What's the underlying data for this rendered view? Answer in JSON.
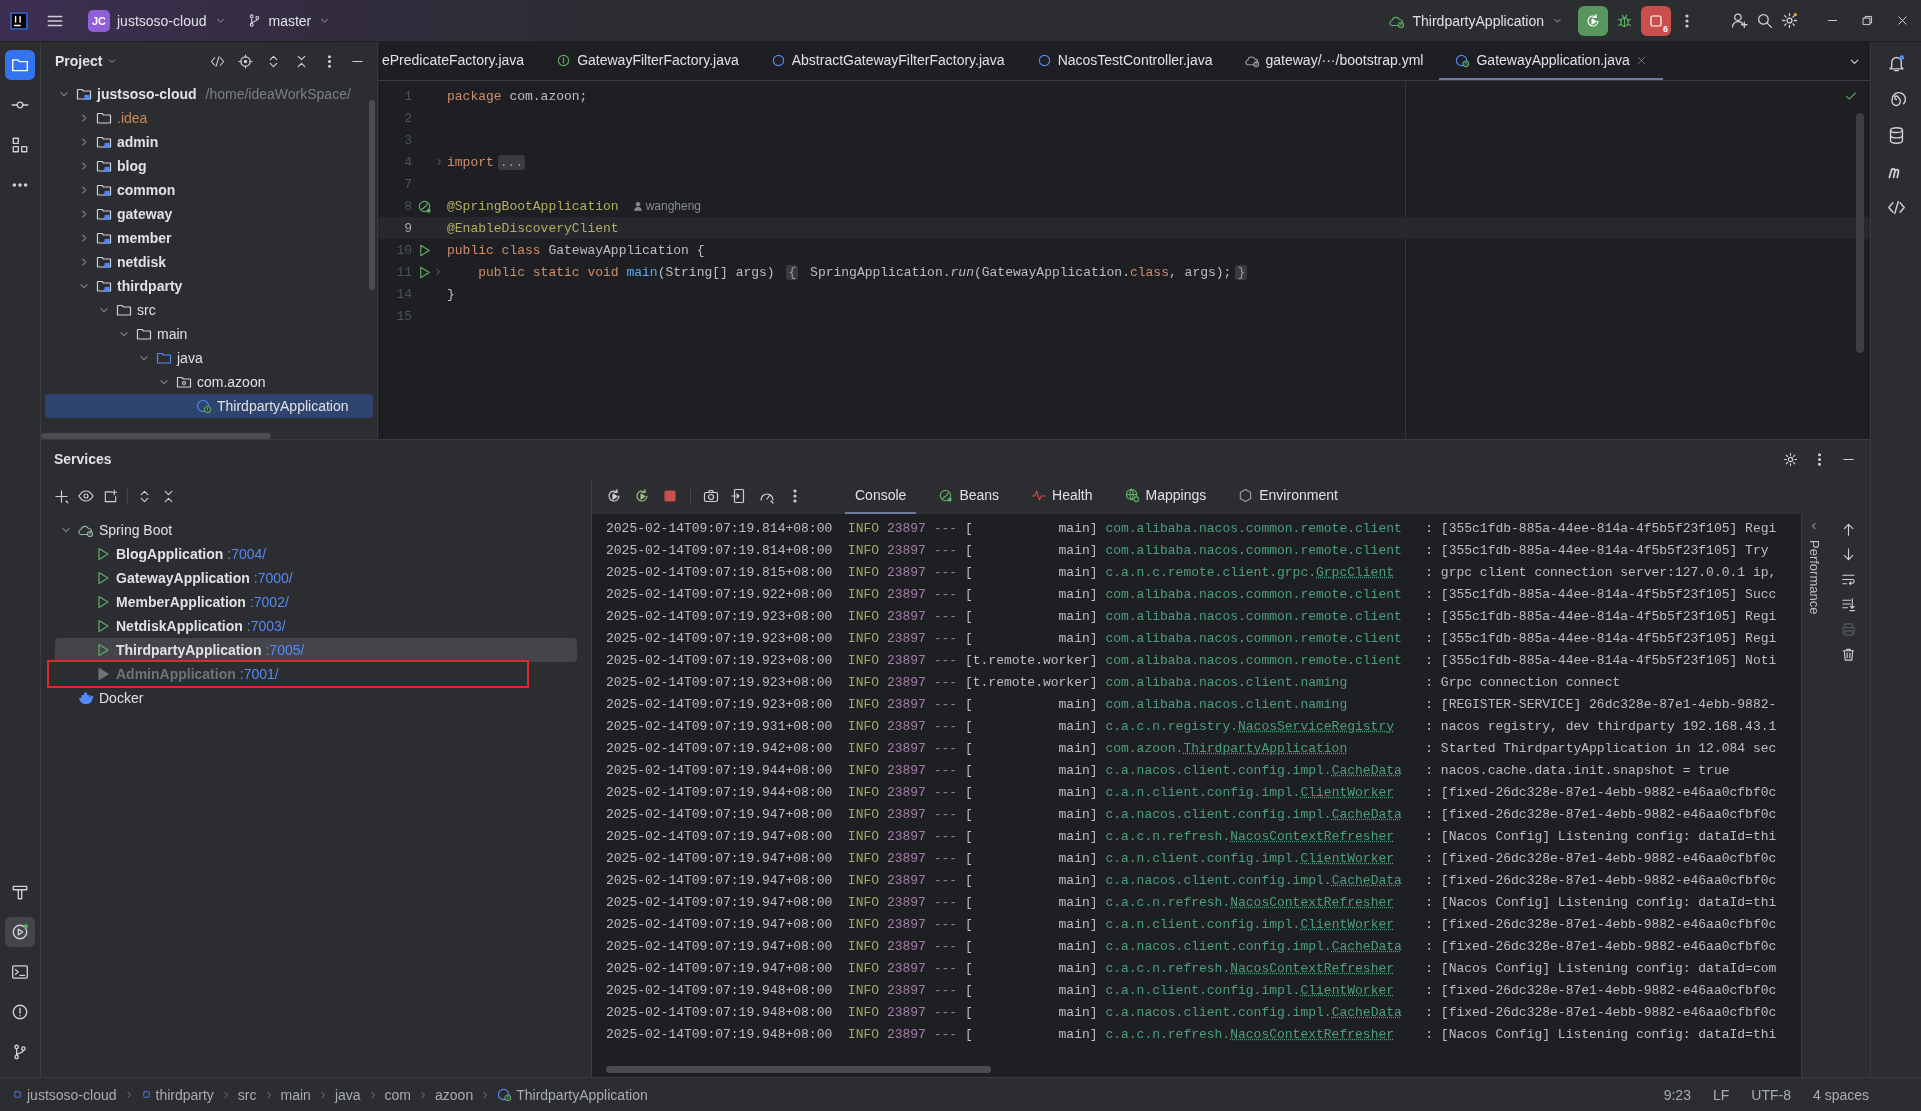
{
  "titlebar": {
    "project_badge": "JC",
    "project": "justsoso-cloud",
    "branch": "master",
    "run_config": "ThirdpartyApplication",
    "stop_count": "6"
  },
  "toolstrip": {
    "top": [
      {
        "kind": "project",
        "selected": true
      },
      {
        "kind": "commit",
        "selected": false
      },
      {
        "kind": "structure",
        "selected": false
      },
      {
        "kind": "more",
        "selected": false
      }
    ],
    "bottom": [
      {
        "kind": "build",
        "selected": false
      },
      {
        "kind": "services",
        "selected": true
      },
      {
        "kind": "terminal",
        "selected": false
      },
      {
        "kind": "problems",
        "selected": false
      },
      {
        "kind": "git",
        "selected": false
      }
    ]
  },
  "rightstrip": [
    {
      "kind": "notifications"
    },
    {
      "kind": "assistant"
    },
    {
      "kind": "database"
    },
    {
      "kind": "maven"
    },
    {
      "kind": "endpoints"
    }
  ],
  "project": {
    "title": "Project",
    "tree": [
      {
        "label": "justsoso-cloud",
        "kind": "module",
        "path": "/home/ideaWorkSpace/",
        "expanded": true,
        "selected": false,
        "children": [
          {
            "label": ".idea",
            "kind": "ignored",
            "expanded": false,
            "selected": false
          },
          {
            "label": "admin",
            "kind": "module",
            "expanded": false,
            "selected": false
          },
          {
            "label": "blog",
            "kind": "module",
            "expanded": false,
            "selected": false
          },
          {
            "label": "common",
            "kind": "module",
            "expanded": false,
            "selected": false
          },
          {
            "label": "gateway",
            "kind": "module",
            "expanded": false,
            "selected": false
          },
          {
            "label": "member",
            "kind": "module",
            "expanded": false,
            "selected": false
          },
          {
            "label": "netdisk",
            "kind": "module",
            "expanded": false,
            "selected": false
          },
          {
            "label": "thirdparty",
            "kind": "module",
            "expanded": true,
            "selected": false,
            "children": [
              {
                "label": "src",
                "kind": "folder",
                "expanded": true,
                "selected": false,
                "children": [
                  {
                    "label": "main",
                    "kind": "folder",
                    "expanded": true,
                    "selected": false,
                    "children": [
                      {
                        "label": "java",
                        "kind": "source",
                        "expanded": true,
                        "selected": false,
                        "children": [
                          {
                            "label": "com.azoon",
                            "kind": "package",
                            "expanded": true,
                            "selected": false,
                            "children": [
                              {
                                "label": "ThirdpartyApplication",
                                "kind": "spring-class",
                                "selected": true
                              }
                            ]
                          }
                        ]
                      }
                    ]
                  }
                ]
              }
            ]
          }
        ]
      }
    ]
  },
  "editor": {
    "tabs": [
      {
        "label": "ePredicateFactory.java",
        "selected": false
      },
      {
        "label": "GatewayFilterFactory.java",
        "kind": "interface",
        "selected": false
      },
      {
        "label": "AbstractGatewayFilterFactory.java",
        "kind": "class",
        "selected": false
      },
      {
        "label": "NacosTestController.java",
        "kind": "class",
        "selected": false
      },
      {
        "label": "gateway/···/bootstrap.yml",
        "kind": "yaml",
        "selected": false
      },
      {
        "label": "GatewayApplication.java",
        "kind": "spring",
        "selected": true
      }
    ],
    "lines": [
      {
        "number": "1",
        "current": false,
        "code": [
          {
            "kind": "kw",
            "text": "package"
          },
          {
            "kind": "plain",
            "text": " com.azoon;"
          }
        ]
      },
      {
        "number": "2",
        "current": false
      },
      {
        "number": "3",
        "current": false
      },
      {
        "number": "4",
        "current": false,
        "folded": true,
        "code": [
          {
            "kind": "kw",
            "text": "import"
          },
          {
            "kind": "fold",
            "text": "..."
          }
        ]
      },
      {
        "number": "7",
        "current": false
      },
      {
        "number": "8",
        "current": false,
        "gutter": {
          "kind": "bean"
        },
        "code": [
          {
            "kind": "ann",
            "text": "@SpringBootApplication"
          },
          {
            "kind": "hint",
            "text": "wangheng"
          }
        ]
      },
      {
        "number": "9",
        "current": true,
        "code": [
          {
            "kind": "ann",
            "text": "@EnableDiscoveryClient"
          }
        ]
      },
      {
        "number": "10",
        "current": false,
        "gutter": {
          "kind": "run"
        },
        "code": [
          {
            "kind": "kw",
            "text": "public class"
          },
          {
            "kind": "plain",
            "text": " GatewayApplication {"
          }
        ]
      },
      {
        "number": "11",
        "current": false,
        "gutter": {
          "kind": "run"
        },
        "folded": true,
        "indented": true,
        "code": [
          {
            "kind": "kw",
            "text": "public static void "
          },
          {
            "kind": "fn",
            "text": "main"
          },
          {
            "kind": "plain",
            "text": "(String[] args) "
          },
          {
            "kind": "fold",
            "text": "{"
          },
          {
            "kind": "plain",
            "text": " SpringApplication."
          },
          {
            "kind": "italic",
            "text": "run"
          },
          {
            "kind": "plain",
            "text": "(GatewayApplication."
          },
          {
            "kind": "kw",
            "text": "class"
          },
          {
            "kind": "plain",
            "text": ", args);"
          },
          {
            "kind": "fold",
            "text": "}"
          }
        ]
      },
      {
        "number": "14",
        "current": false,
        "code": [
          {
            "kind": "plain",
            "text": "}"
          }
        ]
      },
      {
        "number": "15",
        "current": false
      }
    ]
  },
  "services": {
    "title": "Services",
    "tree": [
      {
        "label": "Spring Boot",
        "kind": "spring",
        "expanded": true,
        "selected": false,
        "children": [
          {
            "label": "BlogApplication",
            "kind": "app",
            "port": ":7004/",
            "running": true,
            "selected": false,
            "marked": false
          },
          {
            "label": "GatewayApplication",
            "kind": "app",
            "port": ":7000/",
            "running": true,
            "selected": false,
            "marked": false
          },
          {
            "label": "MemberApplication",
            "kind": "app",
            "port": ":7002/",
            "running": true,
            "selected": false,
            "marked": false
          },
          {
            "label": "NetdiskApplication",
            "kind": "app",
            "port": ":7003/",
            "running": true,
            "selected": false,
            "marked": false
          },
          {
            "label": "ThirdpartyApplication",
            "kind": "app",
            "port": ":7005/",
            "running": true,
            "selected": true,
            "marked": false
          },
          {
            "label": "AdminApplication",
            "kind": "app",
            "port": ":7001/",
            "running": false,
            "selected": false,
            "marked": true
          }
        ]
      },
      {
        "label": "Docker",
        "kind": "docker",
        "selected": false
      }
    ],
    "console": {
      "tabs": [
        {
          "label": "Console",
          "kind": "console",
          "selected": true
        },
        {
          "label": "Beans",
          "kind": "beans",
          "selected": false
        },
        {
          "label": "Health",
          "kind": "health",
          "selected": false
        },
        {
          "label": "Mappings",
          "kind": "mappings",
          "selected": false
        },
        {
          "label": "Environment",
          "kind": "environment",
          "selected": false
        }
      ],
      "side_tab": "Performance",
      "rows": [
        {
          "time": "2025-02-14T09:07:19.814+08:00",
          "level": "INFO",
          "pid": "23897",
          "sep": "---",
          "thread": "[           main]",
          "logger": "com.alibaba.nacos.common.remote.client",
          "colon": ":",
          "message": "[355c1fdb-885a-44ee-814a-4f5b5f23f105] Regi"
        },
        {
          "time": "2025-02-14T09:07:19.814+08:00",
          "level": "INFO",
          "pid": "23897",
          "sep": "---",
          "thread": "[           main]",
          "logger": "com.alibaba.nacos.common.remote.client",
          "colon": ":",
          "message": "[355c1fdb-885a-44ee-814a-4f5b5f23f105] Try"
        },
        {
          "time": "2025-02-14T09:07:19.815+08:00",
          "level": "INFO",
          "pid": "23897",
          "sep": "---",
          "thread": "[           main]",
          "logger": "c.a.n.c.remote.client.grpc.",
          "logger_link": "GrpcClient",
          "colon": ":",
          "message": "grpc client connection server:127.0.0.1 ip,"
        },
        {
          "time": "2025-02-14T09:07:19.922+08:00",
          "level": "INFO",
          "pid": "23897",
          "sep": "---",
          "thread": "[           main]",
          "logger": "com.alibaba.nacos.common.remote.client",
          "colon": ":",
          "message": "[355c1fdb-885a-44ee-814a-4f5b5f23f105] Succ"
        },
        {
          "time": "2025-02-14T09:07:19.923+08:00",
          "level": "INFO",
          "pid": "23897",
          "sep": "---",
          "thread": "[           main]",
          "logger": "com.alibaba.nacos.common.remote.client",
          "colon": ":",
          "message": "[355c1fdb-885a-44ee-814a-4f5b5f23f105] Regi"
        },
        {
          "time": "2025-02-14T09:07:19.923+08:00",
          "level": "INFO",
          "pid": "23897",
          "sep": "---",
          "thread": "[           main]",
          "logger": "com.alibaba.nacos.common.remote.client",
          "colon": ":",
          "message": "[355c1fdb-885a-44ee-814a-4f5b5f23f105] Regi"
        },
        {
          "time": "2025-02-14T09:07:19.923+08:00",
          "level": "INFO",
          "pid": "23897",
          "sep": "---",
          "thread": "[t.remote.worker]",
          "logger": "com.alibaba.nacos.common.remote.client",
          "colon": ":",
          "message": "[355c1fdb-885a-44ee-814a-4f5b5f23f105] Noti"
        },
        {
          "time": "2025-02-14T09:07:19.923+08:00",
          "level": "INFO",
          "pid": "23897",
          "sep": "---",
          "thread": "[t.remote.worker]",
          "logger": "com.alibaba.nacos.client.naming",
          "colon": ":",
          "message": "Grpc connection connect"
        },
        {
          "time": "2025-02-14T09:07:19.923+08:00",
          "level": "INFO",
          "pid": "23897",
          "sep": "---",
          "thread": "[           main]",
          "logger": "com.alibaba.nacos.client.naming",
          "colon": ":",
          "message": "[REGISTER-SERVICE] 26dc328e-87e1-4ebb-9882-"
        },
        {
          "time": "2025-02-14T09:07:19.931+08:00",
          "level": "INFO",
          "pid": "23897",
          "sep": "---",
          "thread": "[           main]",
          "logger": "c.a.c.n.registry.",
          "logger_link": "NacosServiceRegistry",
          "colon": ":",
          "message": "nacos registry, dev thirdparty 192.168.43.1"
        },
        {
          "time": "2025-02-14T09:07:19.942+08:00",
          "level": "INFO",
          "pid": "23897",
          "sep": "---",
          "thread": "[           main]",
          "logger": "com.azoon.",
          "logger_link": "ThirdpartyApplication",
          "colon": ":",
          "message": "Started ThirdpartyApplication in 12.084 sec"
        },
        {
          "time": "2025-02-14T09:07:19.944+08:00",
          "level": "INFO",
          "pid": "23897",
          "sep": "---",
          "thread": "[           main]",
          "logger": "c.a.nacos.client.config.impl.",
          "logger_link": "CacheData",
          "colon": ":",
          "message": "nacos.cache.data.init.snapshot = true"
        },
        {
          "time": "2025-02-14T09:07:19.944+08:00",
          "level": "INFO",
          "pid": "23897",
          "sep": "---",
          "thread": "[           main]",
          "logger": "c.a.n.client.config.impl.",
          "logger_link": "ClientWorker",
          "colon": ":",
          "message": "[fixed-26dc328e-87e1-4ebb-9882-e46aa0cfbf0c"
        },
        {
          "time": "2025-02-14T09:07:19.947+08:00",
          "level": "INFO",
          "pid": "23897",
          "sep": "---",
          "thread": "[           main]",
          "logger": "c.a.nacos.client.config.impl.",
          "logger_link": "CacheData",
          "colon": ":",
          "message": "[fixed-26dc328e-87e1-4ebb-9882-e46aa0cfbf0c"
        },
        {
          "time": "2025-02-14T09:07:19.947+08:00",
          "level": "INFO",
          "pid": "23897",
          "sep": "---",
          "thread": "[           main]",
          "logger": "c.a.c.n.refresh.",
          "logger_link": "NacosContextRefresher",
          "colon": ":",
          "message": "[Nacos Config] Listening config: dataId=thi"
        },
        {
          "time": "2025-02-14T09:07:19.947+08:00",
          "level": "INFO",
          "pid": "23897",
          "sep": "---",
          "thread": "[           main]",
          "logger": "c.a.n.client.config.impl.",
          "logger_link": "ClientWorker",
          "colon": ":",
          "message": "[fixed-26dc328e-87e1-4ebb-9882-e46aa0cfbf0c"
        },
        {
          "time": "2025-02-14T09:07:19.947+08:00",
          "level": "INFO",
          "pid": "23897",
          "sep": "---",
          "thread": "[           main]",
          "logger": "c.a.nacos.client.config.impl.",
          "logger_link": "CacheData",
          "colon": ":",
          "message": "[fixed-26dc328e-87e1-4ebb-9882-e46aa0cfbf0c"
        },
        {
          "time": "2025-02-14T09:07:19.947+08:00",
          "level": "INFO",
          "pid": "23897",
          "sep": "---",
          "thread": "[           main]",
          "logger": "c.a.c.n.refresh.",
          "logger_link": "NacosContextRefresher",
          "colon": ":",
          "message": "[Nacos Config] Listening config: dataId=thi"
        },
        {
          "time": "2025-02-14T09:07:19.947+08:00",
          "level": "INFO",
          "pid": "23897",
          "sep": "---",
          "thread": "[           main]",
          "logger": "c.a.n.client.config.impl.",
          "logger_link": "ClientWorker",
          "colon": ":",
          "message": "[fixed-26dc328e-87e1-4ebb-9882-e46aa0cfbf0c"
        },
        {
          "time": "2025-02-14T09:07:19.947+08:00",
          "level": "INFO",
          "pid": "23897",
          "sep": "---",
          "thread": "[           main]",
          "logger": "c.a.nacos.client.config.impl.",
          "logger_link": "CacheData",
          "colon": ":",
          "message": "[fixed-26dc328e-87e1-4ebb-9882-e46aa0cfbf0c"
        },
        {
          "time": "2025-02-14T09:07:19.947+08:00",
          "level": "INFO",
          "pid": "23897",
          "sep": "---",
          "thread": "[           main]",
          "logger": "c.a.c.n.refresh.",
          "logger_link": "NacosContextRefresher",
          "colon": ":",
          "message": "[Nacos Config] Listening config: dataId=com"
        },
        {
          "time": "2025-02-14T09:07:19.948+08:00",
          "level": "INFO",
          "pid": "23897",
          "sep": "---",
          "thread": "[           main]",
          "logger": "c.a.n.client.config.impl.",
          "logger_link": "ClientWorker",
          "colon": ":",
          "message": "[fixed-26dc328e-87e1-4ebb-9882-e46aa0cfbf0c"
        },
        {
          "time": "2025-02-14T09:07:19.948+08:00",
          "level": "INFO",
          "pid": "23897",
          "sep": "---",
          "thread": "[           main]",
          "logger": "c.a.nacos.client.config.impl.",
          "logger_link": "CacheData",
          "colon": ":",
          "message": "[fixed-26dc328e-87e1-4ebb-9882-e46aa0cfbf0c"
        },
        {
          "time": "2025-02-14T09:07:19.948+08:00",
          "level": "INFO",
          "pid": "23897",
          "sep": "---",
          "thread": "[           main]",
          "logger": "c.a.c.n.refresh.",
          "logger_link": "NacosContextRefresher",
          "colon": ":",
          "message": "[Nacos Config] Listening config: dataId=thi"
        }
      ]
    }
  },
  "statusbar": {
    "breadcrumbs": [
      {
        "label": "justsoso-cloud",
        "kind": "module"
      },
      {
        "label": "thirdparty",
        "kind": "module"
      },
      {
        "label": "src"
      },
      {
        "label": "main"
      },
      {
        "label": "java"
      },
      {
        "label": "com"
      },
      {
        "label": "azoon"
      },
      {
        "label": "ThirdpartyApplication",
        "kind": "spring-class"
      }
    ],
    "info": [
      "9:23",
      "LF",
      "UTF-8",
      "4 spaces"
    ]
  }
}
